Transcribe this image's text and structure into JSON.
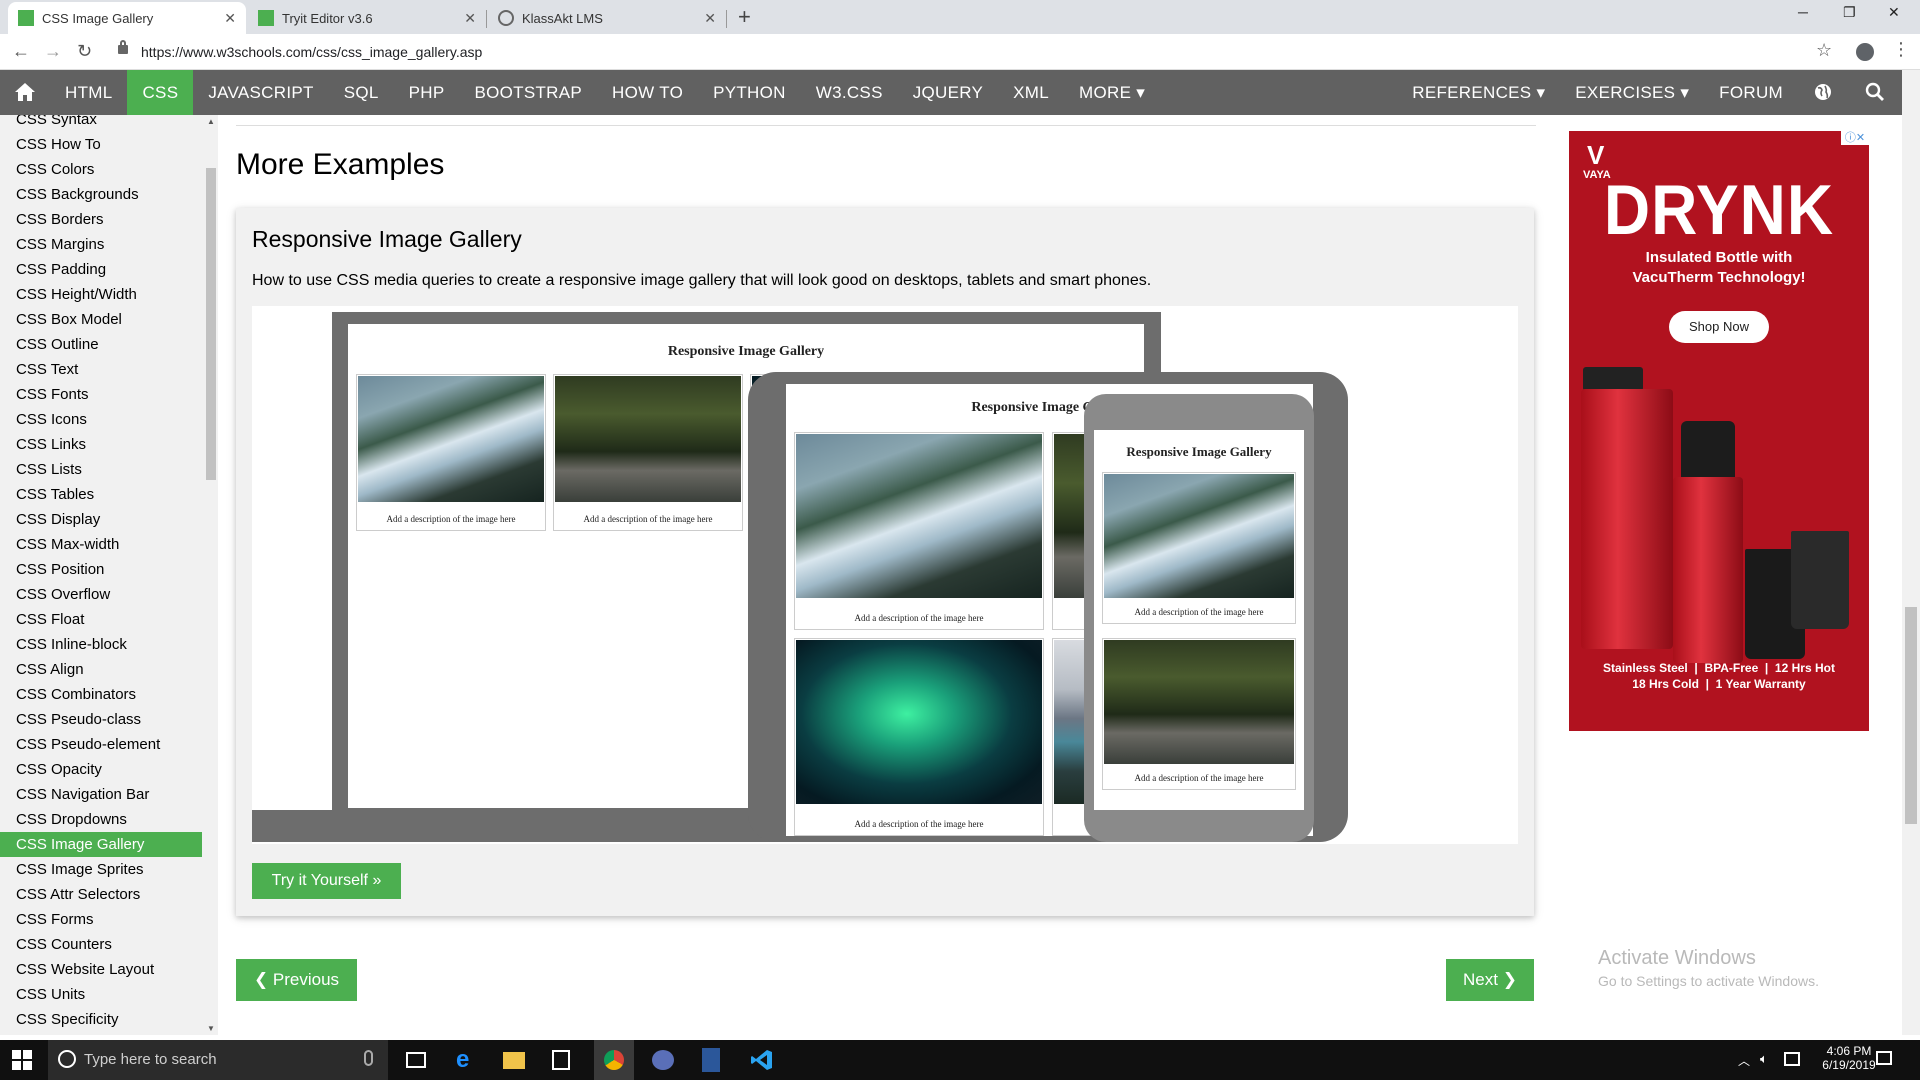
{
  "browser": {
    "tabs": [
      {
        "label": "CSS Image Gallery",
        "active": true
      },
      {
        "label": "Tryit Editor v3.6",
        "active": false
      },
      {
        "label": "KlassAkt LMS",
        "active": false
      }
    ],
    "url": "https://www.w3schools.com/css/css_image_gallery.asp"
  },
  "topnav": {
    "items": [
      "HTML",
      "CSS",
      "JAVASCRIPT",
      "SQL",
      "PHP",
      "BOOTSTRAP",
      "HOW TO",
      "PYTHON",
      "W3.CSS",
      "JQUERY",
      "XML",
      "MORE ▾"
    ],
    "active": "CSS",
    "right_items": [
      "REFERENCES ▾",
      "EXERCISES ▾",
      "FORUM"
    ]
  },
  "sidebar": {
    "items": [
      "CSS Syntax",
      "CSS How To",
      "CSS Colors",
      "CSS Backgrounds",
      "CSS Borders",
      "CSS Margins",
      "CSS Padding",
      "CSS Height/Width",
      "CSS Box Model",
      "CSS Outline",
      "CSS Text",
      "CSS Fonts",
      "CSS Icons",
      "CSS Links",
      "CSS Lists",
      "CSS Tables",
      "CSS Display",
      "CSS Max-width",
      "CSS Position",
      "CSS Overflow",
      "CSS Float",
      "CSS Inline-block",
      "CSS Align",
      "CSS Combinators",
      "CSS Pseudo-class",
      "CSS Pseudo-element",
      "CSS Opacity",
      "CSS Navigation Bar",
      "CSS Dropdowns",
      "CSS Image Gallery",
      "CSS Image Sprites",
      "CSS Attr Selectors",
      "CSS Forms",
      "CSS Counters",
      "CSS Website Layout",
      "CSS Units",
      "CSS Specificity"
    ],
    "active": "CSS Image Gallery"
  },
  "main": {
    "heading": "More Examples",
    "panel_title": "Responsive Image Gallery",
    "panel_desc": "How to use CSS media queries to create a responsive image gallery that will look good on desktops, tablets and smart phones.",
    "gallery_title": "Responsive Image Gallery",
    "caption": "Add a description of the image here",
    "tryit_label": "Try it Yourself »",
    "prev_label": "❮ Previous",
    "next_label": "Next ❯"
  },
  "ad": {
    "brand": "VAYA",
    "headline": "DRYNK",
    "line1": "Insulated Bottle with",
    "line2": "VacuTherm Technology!",
    "cta": "Shop Now",
    "footer1": "Stainless Steel  |  BPA-Free  |  12 Hrs Hot",
    "footer2": "18 Hrs Cold  |  1 Year Warranty"
  },
  "watermark": {
    "line1": "Activate Windows",
    "line2": "Go to Settings to activate Windows."
  },
  "taskbar": {
    "search_placeholder": "Type here to search",
    "time": "4:06 PM",
    "date": "6/19/2019"
  },
  "colors": {
    "accent": "#4CAF50",
    "nav_bg": "#616161",
    "ad_bg": "#b1121f"
  }
}
